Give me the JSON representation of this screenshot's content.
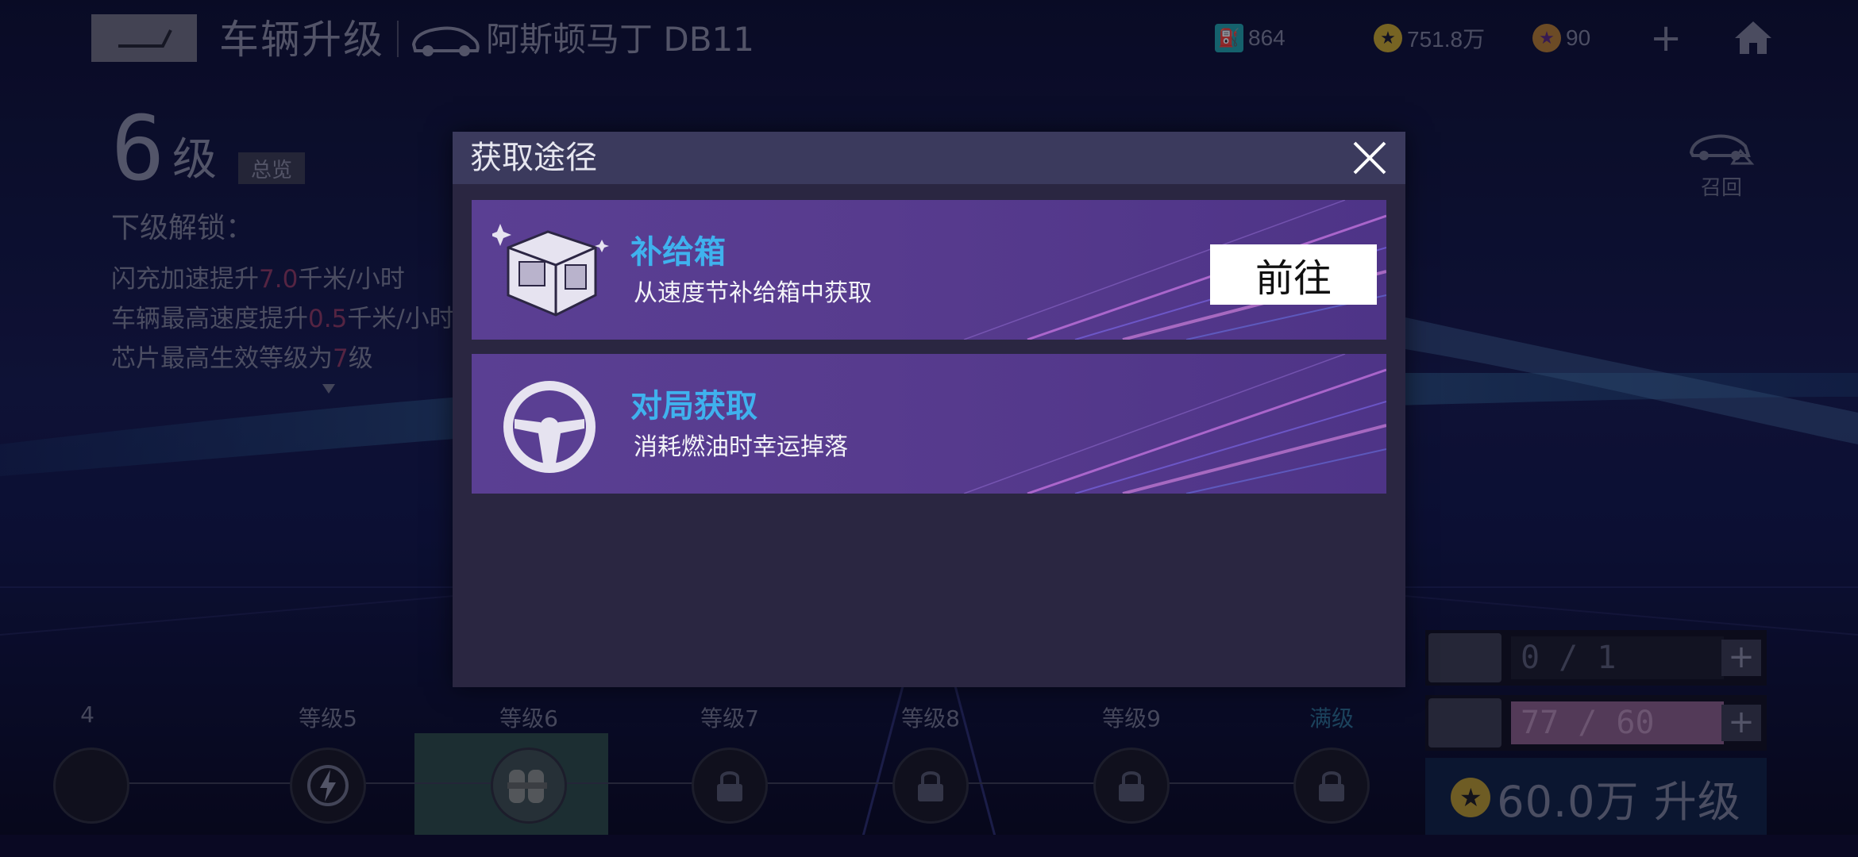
{
  "topbar": {
    "title": "车辆升级",
    "car_name": "阿斯顿马丁 DB11",
    "resources": [
      {
        "icon": "fuel-icon",
        "value": "864",
        "color": "#1fa3a8"
      },
      {
        "icon": "gold-coin-icon",
        "value": "751.8万",
        "color": "#c9a72a"
      },
      {
        "icon": "gem-coin-icon",
        "value": "90",
        "color": "#b57c2d"
      }
    ]
  },
  "level_info": {
    "level_number": "6",
    "level_unit": "级",
    "overview_label": "总览",
    "unlock_title": "下级解锁：",
    "unlock_lines": [
      {
        "prefix": "闪充加速提升",
        "value": "7.0",
        "suffix": "千米/小时"
      },
      {
        "prefix": "车辆最高速度提升",
        "value": "0.5",
        "suffix": "千米/小时"
      },
      {
        "prefix": "芯片最高生效等级为",
        "value": "7",
        "suffix": "级"
      }
    ]
  },
  "recall": {
    "label": "召回"
  },
  "track": {
    "edge_label": "4",
    "levels": [
      "等级5",
      "等级6",
      "等级7",
      "等级8",
      "等级9",
      "满级"
    ]
  },
  "upgrade_panel": {
    "parts_count": "0 / 1",
    "cards_count": "77 / 60",
    "plus": "+",
    "cost_label": "60.0万 升级",
    "coin_symbol": "★"
  },
  "modal": {
    "title": "获取途径",
    "sources": [
      {
        "name": "补给箱",
        "desc": "从速度节补给箱中获取",
        "button": "前往",
        "icon": "supply-box-icon"
      },
      {
        "name": "对局获取",
        "desc": "消耗燃油时幸运掉落",
        "icon": "steering-wheel-icon"
      }
    ]
  }
}
